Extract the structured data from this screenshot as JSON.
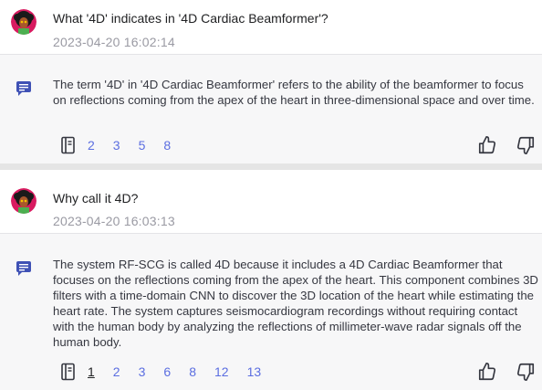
{
  "conversation": [
    {
      "question": "What '4D' indicates in '4D Cardiac Beamformer'?",
      "timestamp": "2023-04-20 16:02:14",
      "answer": "The term '4D' in '4D Cardiac Beamformer' refers to the ability of the beamformer to focus on reflections coming from the apex of the heart in three-dimensional space and over time.",
      "sources": [
        "2",
        "3",
        "5",
        "8"
      ]
    },
    {
      "question": "Why call it 4D?",
      "timestamp": "2023-04-20 16:03:13",
      "answer": "The system RF-SCG is called 4D because it includes a 4D Cardiac Beamformer that focuses on the reflections coming from the apex of the heart. This component combines 3D filters with a time-domain CNN to discover the 3D location of the heart while estimating the heart rate. The system captures seismocardiogram recordings without requiring contact with the human body by analyzing the reflections of millimeter-wave radar signals off the human body.",
      "sources": [
        "1",
        "2",
        "3",
        "6",
        "8",
        "12",
        "13"
      ],
      "active_source": "1"
    }
  ],
  "icons": {
    "avatar": "user-avatar-icon",
    "bot": "chat-bubble-icon",
    "sources": "book-icon",
    "like": "thumbs-up-icon",
    "dislike": "thumbs-down-icon"
  },
  "colors": {
    "link": "#5b6ee1",
    "bot_icon": "#3f51b5",
    "timestamp": "#9a9aa3",
    "separator": "#e5e5e5"
  }
}
